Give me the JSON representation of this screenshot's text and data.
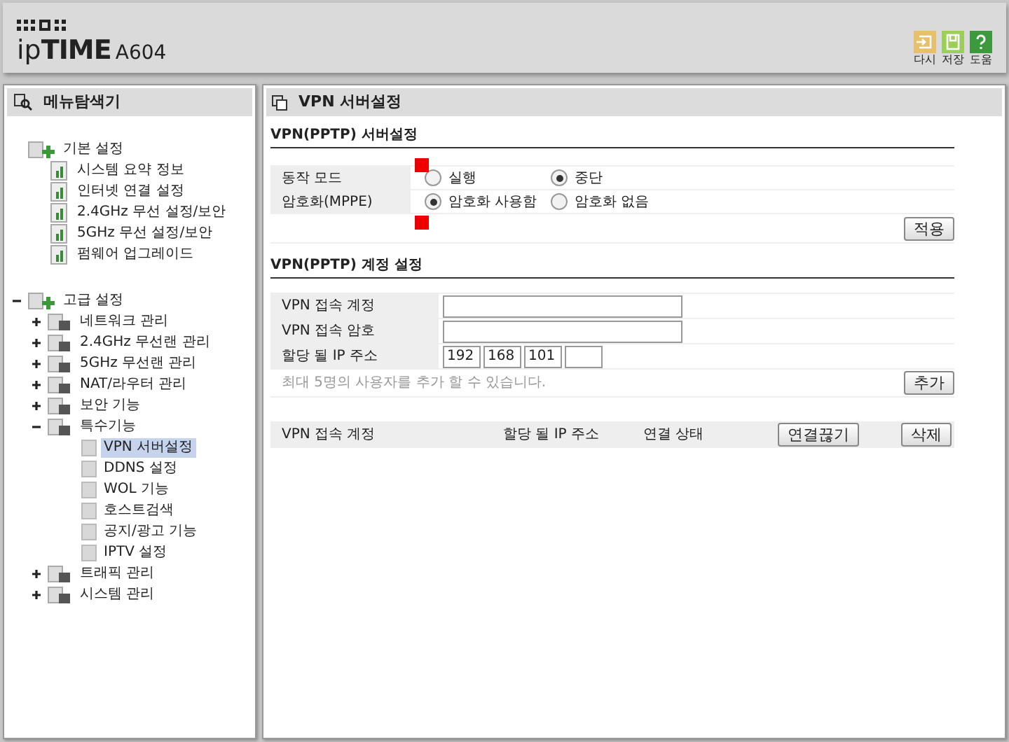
{
  "header": {
    "logo_brand_prefix": "ip",
    "logo_brand_main": "TIME",
    "model": "A604",
    "actions": [
      {
        "label": "다시",
        "kind": "reload"
      },
      {
        "label": "저장",
        "kind": "save"
      },
      {
        "label": "도움",
        "kind": "help"
      }
    ]
  },
  "sidebar": {
    "title": "메뉴탐색기",
    "items": [
      {
        "label": "기본 설정",
        "kind": "group",
        "children": [
          {
            "label": "시스템 요약 정보",
            "kind": "section"
          },
          {
            "label": "인터넷 연결 설정",
            "kind": "section"
          },
          {
            "label": "2.4GHz 무선 설정/보안",
            "kind": "section"
          },
          {
            "label": "5GHz 무선 설정/보안",
            "kind": "section"
          },
          {
            "label": "펌웨어 업그레이드",
            "kind": "section"
          }
        ]
      },
      {
        "label": "고급 설정",
        "kind": "group",
        "expanded": true,
        "children": [
          {
            "label": "네트워크 관리",
            "kind": "folder",
            "expanded": false
          },
          {
            "label": "2.4GHz 무선랜 관리",
            "kind": "folder",
            "expanded": false
          },
          {
            "label": "5GHz 무선랜 관리",
            "kind": "folder",
            "expanded": false
          },
          {
            "label": "NAT/라우터 관리",
            "kind": "folder",
            "expanded": false
          },
          {
            "label": "보안 기능",
            "kind": "folder",
            "expanded": false
          },
          {
            "label": "특수기능",
            "kind": "folder",
            "expanded": true,
            "children": [
              {
                "label": "VPN 서버설정",
                "kind": "page",
                "selected": true
              },
              {
                "label": "DDNS 설정",
                "kind": "page",
                "selected": false
              },
              {
                "label": "WOL 기능",
                "kind": "page",
                "selected": false
              },
              {
                "label": "호스트검색",
                "kind": "page",
                "selected": false
              },
              {
                "label": "공지/광고 기능",
                "kind": "page",
                "selected": false
              },
              {
                "label": "IPTV 설정",
                "kind": "page",
                "selected": false
              }
            ]
          },
          {
            "label": "트래픽 관리",
            "kind": "folder",
            "expanded": false
          },
          {
            "label": "시스템 관리",
            "kind": "folder",
            "expanded": false
          }
        ]
      }
    ]
  },
  "main": {
    "title": "VPN 서버설정",
    "server": {
      "heading": "VPN(PPTP) 서버설정",
      "rows": [
        {
          "label": "동작 모드",
          "options": [
            {
              "label": "실행",
              "selected": false
            },
            {
              "label": "중단",
              "selected": true
            }
          ]
        },
        {
          "label": "암호화(MPPE)",
          "options": [
            {
              "label": "암호화 사용함",
              "selected": true
            },
            {
              "label": "암호화 없음",
              "selected": false
            }
          ]
        }
      ],
      "apply": "적용"
    },
    "account": {
      "heading": "VPN(PPTP) 계정 설정",
      "fields": [
        {
          "label": "VPN 접속 계정",
          "kind": "text"
        },
        {
          "label": "VPN 접속 암호",
          "kind": "text"
        },
        {
          "label": "할당 될 IP 주소",
          "kind": "ip",
          "octets": [
            "192",
            "168",
            "101"
          ],
          "trailing_empty_octet": true
        }
      ],
      "hint": "최대 5명의 사용자를 추가 할 수 있습니다.",
      "add": "추가",
      "columns": [
        "VPN 접속 계정",
        "할당 될 IP 주소",
        "연결 상태"
      ],
      "disconnect": "연결끊기",
      "delete": "삭제"
    }
  }
}
